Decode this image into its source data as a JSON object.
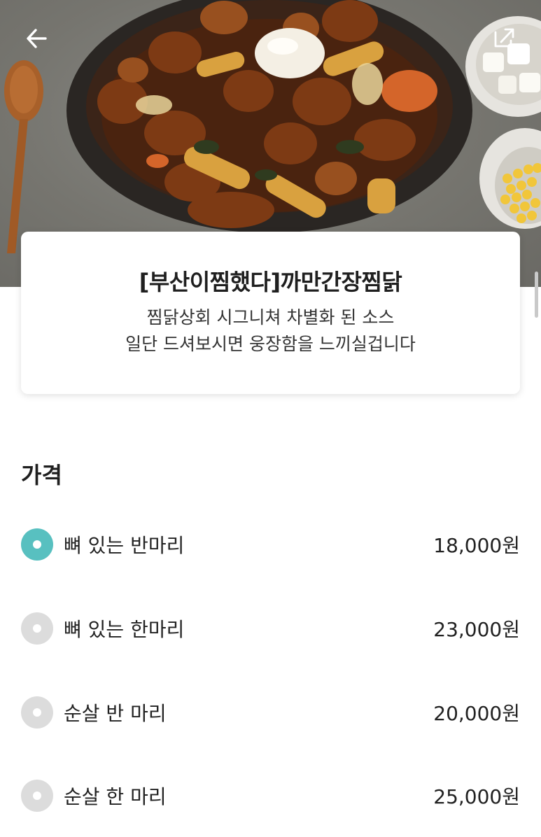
{
  "hero": {
    "image_alt": "찜닭 요리 사진"
  },
  "nav": {
    "back_icon": "arrow-left-icon",
    "share_icon": "external-share-icon"
  },
  "menu": {
    "title": "[부산이찜했다]까만간장찜닭",
    "description_line1": "찜닭상회 시그니쳐 차별화 된 소스",
    "description_line2": "일단 드셔보시면 웅장함을 느끼실겁니다"
  },
  "price_section": {
    "heading": "가격",
    "options": [
      {
        "label": "뼈 있는 반마리",
        "price": "18,000원",
        "selected": true
      },
      {
        "label": "뼈 있는 한마리",
        "price": "23,000원",
        "selected": false
      },
      {
        "label": "순살 반 마리",
        "price": "20,000원",
        "selected": false
      },
      {
        "label": "순살 한 마리",
        "price": "25,000원",
        "selected": false
      }
    ]
  },
  "colors": {
    "accent": "#58c0c0",
    "radio_unselected": "#dcdcdc",
    "text": "#222222"
  }
}
